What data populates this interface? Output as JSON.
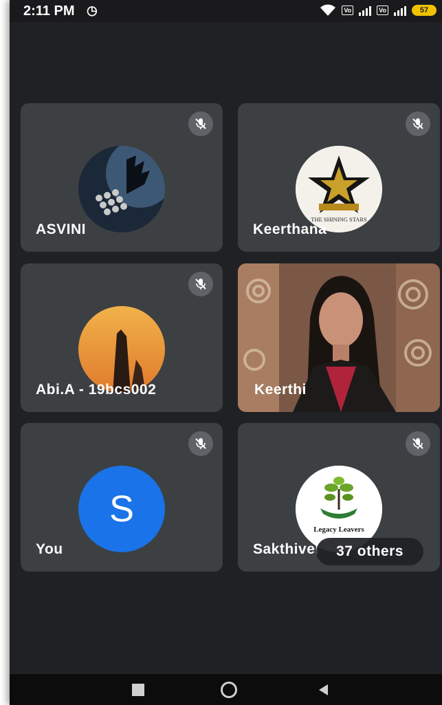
{
  "status_bar": {
    "time": "2:11 PM",
    "battery": "57",
    "icons": [
      "alarm-icon",
      "wifi-icon",
      "volte-icon",
      "signal-icon",
      "battery-icon"
    ]
  },
  "participants": [
    {
      "name": "ASVINI",
      "avatar": "hands-image",
      "muted": true
    },
    {
      "name": "Keerthana",
      "avatar": "shining-stars-logo",
      "avatar_text": "THE SHINING STARS",
      "muted": true
    },
    {
      "name": "Abi.A - 19bcs002",
      "avatar": "mountain-image",
      "muted": true
    },
    {
      "name": "Keerthi",
      "avatar": "camera-video",
      "muted": false
    },
    {
      "name": "You",
      "avatar_letter": "S",
      "muted": true
    },
    {
      "name": "Sakthivel",
      "avatar": "legacy-leavers-logo",
      "avatar_text": "Legacy Leavers",
      "muted": true
    }
  ],
  "others_pill": "37 others",
  "colors": {
    "background": "#202124",
    "tile": "#3c4043",
    "mic_badge": "#5f6368",
    "avatar_blue": "#1a73e8",
    "battery": "#f2c200"
  }
}
